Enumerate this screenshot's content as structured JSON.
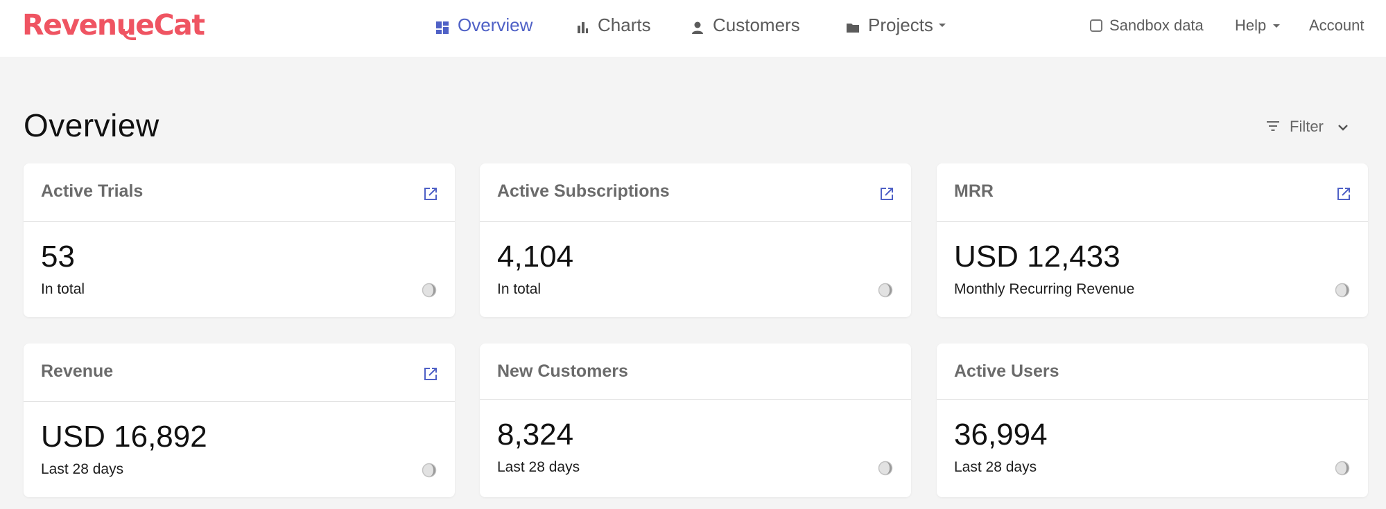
{
  "brand": {
    "name": "RevenueCat",
    "color": "#ef5462"
  },
  "nav": {
    "items": [
      {
        "label": "Overview",
        "icon": "dashboard-icon",
        "active": true
      },
      {
        "label": "Charts",
        "icon": "bar-chart-icon",
        "active": false
      },
      {
        "label": "Customers",
        "icon": "person-icon",
        "active": false
      },
      {
        "label": "Projects",
        "icon": "folder-icon",
        "active": false,
        "dropdown": true
      }
    ],
    "accent": "#4f61c6"
  },
  "header_right": {
    "sandbox_label": "Sandbox data",
    "sandbox_checked": false,
    "help_label": "Help",
    "account_label": "Account"
  },
  "page": {
    "title": "Overview",
    "filter_label": "Filter"
  },
  "cards": [
    {
      "title": "Active Trials",
      "value": "53",
      "subtitle": "In total",
      "has_link": true
    },
    {
      "title": "Active Subscriptions",
      "value": "4,104",
      "subtitle": "In total",
      "has_link": true
    },
    {
      "title": "MRR",
      "value": "USD 12,433",
      "subtitle": "Monthly Recurring Revenue",
      "has_link": true
    },
    {
      "title": "Revenue",
      "value": "USD 16,892",
      "subtitle": "Last 28 days",
      "has_link": true
    },
    {
      "title": "New Customers",
      "value": "8,324",
      "subtitle": "Last 28 days",
      "has_link": false
    },
    {
      "title": "Active Users",
      "value": "36,994",
      "subtitle": "Last 28 days",
      "has_link": false
    }
  ]
}
